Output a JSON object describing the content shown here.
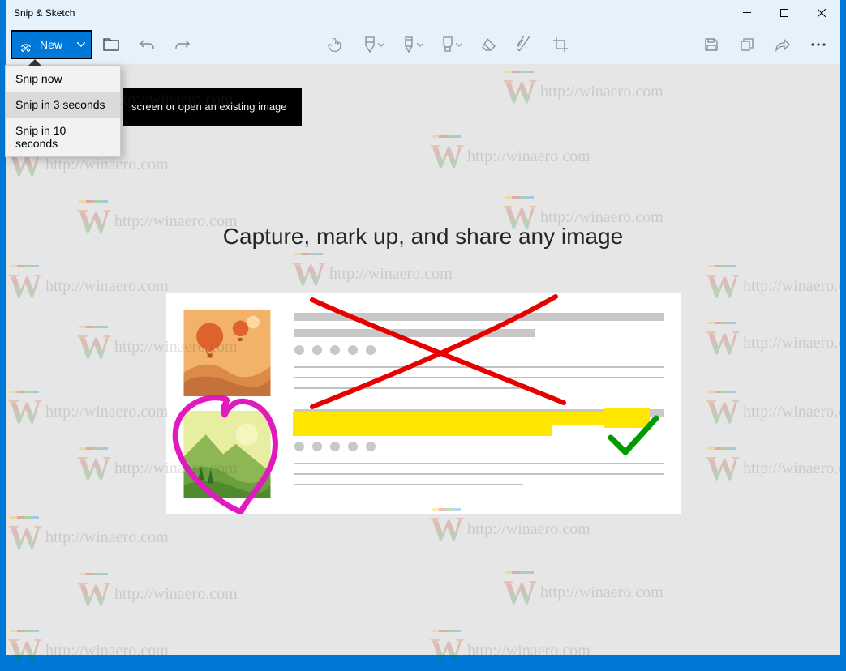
{
  "window": {
    "title": "Snip & Sketch"
  },
  "toolbar": {
    "new_label": "New",
    "tooltip": "screen or open an existing image"
  },
  "dropdown": {
    "items": [
      {
        "label": "Snip now"
      },
      {
        "label": "Snip in 3 seconds"
      },
      {
        "label": "Snip in 10 seconds"
      }
    ],
    "hover_index": 1
  },
  "content": {
    "headline": "Capture, mark up, and share any image"
  },
  "watermark": {
    "text": "http://winaero.com"
  },
  "colors": {
    "blue_border": "#0078d7",
    "toolbar_bg": "#e6f2fb",
    "content_bg": "#e6e6e6",
    "pen_red": "#e60000",
    "pen_green": "#009b00",
    "pen_pink": "#e11abf",
    "highlight_yellow": "#ffe600"
  }
}
